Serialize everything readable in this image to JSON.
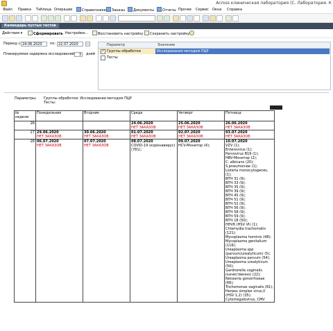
{
  "window": {
    "title": "Across клиническая лаборатория (С. Лаборатория. К"
  },
  "menu": [
    {
      "label": "Файл",
      "icon": "file-icon"
    },
    {
      "label": "Правка",
      "icon": ""
    },
    {
      "label": "Таблица",
      "icon": ""
    },
    {
      "label": "Операции",
      "icon": ""
    },
    {
      "label": "Справочники",
      "icon": "books-icon"
    },
    {
      "label": "Заказы",
      "icon": "orders-icon"
    },
    {
      "label": "Документы",
      "icon": "documents-icon"
    },
    {
      "label": "Отчеты",
      "icon": "reports-icon"
    },
    {
      "label": "Прочее",
      "icon": ""
    },
    {
      "label": "Сервис",
      "icon": ""
    },
    {
      "label": "Окна",
      "icon": ""
    },
    {
      "label": "Справка",
      "icon": ""
    }
  ],
  "tab": {
    "label": "Календарь пустых тестов"
  },
  "commands": {
    "actions": "Действия",
    "generate": "Сформировать",
    "settings": "Настройки...",
    "restore": "Восстановить настройку",
    "save": "Сохранить настройку"
  },
  "period": {
    "label": "Период с:",
    "from": "24.06.2020",
    "to_label": "по:",
    "to": "22.07.2020",
    "more": "..."
  },
  "delay": {
    "label": "Планируемая задержка исследований",
    "value": "3",
    "unit": "дней"
  },
  "params_table": {
    "col_param": "Параметр",
    "col_value": "Значение",
    "rows": [
      {
        "checked": "✓",
        "name": "Группы обработки",
        "value": "Исследования методом ПЦР"
      },
      {
        "checked": "",
        "name": "Тесты",
        "value": ""
      }
    ]
  },
  "report": {
    "params_label": "Параметры:",
    "groups_text": "Группы обработки: Исследования методом ПЦР",
    "tests_text": "Тесты:",
    "headers": [
      "№ недели",
      "Понедельник",
      "Вторник",
      "Среда",
      "Четверг",
      "Пятница"
    ],
    "no_orders": "НЕТ ЗАКАЗОВ",
    "weeks": [
      {
        "num": "26",
        "mon": "",
        "mon_status": "",
        "tue": "",
        "tue_status": "",
        "wed": "24.06.2020",
        "wed_status": "НЕТ ЗАКАЗОВ",
        "thu": "25.06.2020",
        "thu_status": "НЕТ ЗАКАЗОВ",
        "fri": "26.06.2020",
        "fri_status": "НЕТ ЗАКАЗОВ"
      },
      {
        "num": "27",
        "mon": "29.06.2020",
        "mon_status": "НЕТ ЗАКАЗОВ",
        "tue": "30.06.2020",
        "tue_status": "НЕТ ЗАКАЗОВ",
        "wed": "01.07.2020",
        "wed_status": "НЕТ ЗАКАЗОВ",
        "thu": "02.07.2020",
        "thu_status": "НЕТ ЗАКАЗОВ",
        "fri": "03.07.2020",
        "fri_status": "НЕТ ЗАКАЗОВ"
      },
      {
        "num": "28",
        "mon": "06.07.2020",
        "mon_status": "НЕТ ЗАКАЗОВ",
        "tue": "07.07.2020",
        "tue_status": "НЕТ ЗАКАЗОВ",
        "wed": "08.07.2020",
        "wed_status": "",
        "thu": "09.07.2020",
        "thu_status": "",
        "fri": "10.07.2020",
        "fri_status": ""
      }
    ],
    "wed_tests": [
      "COVID-19 (коронавирус)",
      "(781);"
    ],
    "thu_tests": [
      "HCV-Монитор (4);"
    ],
    "fri_tests": [
      "VZV (1);",
      "Enterovirus (1);",
      "Parvovirus B19 (1);",
      "HBV-Монитор (2);",
      "C. albicans (20);",
      "S.pneumoniae (1);",
      "Listeria monocytogenes,",
      "(1);",
      "ВПЧ 31 (9);",
      "ВПЧ 33 (9);",
      "ВПЧ 35 (9);",
      "ВПЧ 39 (9);",
      "ВПЧ 45 (9);",
      "ВПЧ 51 (9);",
      "ВПЧ 52 (9);",
      "ВПЧ 56 (9);",
      "ВПЧ 58 (9);",
      "ВПЧ 59 (9);",
      "ВПЧ 18 (50);",
      "HHV6 (HSV VI) (1);",
      "Chlamydia trachomatis",
      "(121);",
      "Mycoplasma hominis (48);",
      "Mycoplasma genitalium",
      "(116);",
      "Ureaplasma spp",
      "(parvum/urealyticum) (5);",
      "Ureaplasma parvum (54);",
      "Ureaplasma urealyticum",
      "(50);",
      "Gardnerella vaginalis",
      "(качественно) (22);",
      "Neisseria gonorrhoeae",
      "(66);",
      "Trichomonas vaginalis (81);",
      "Herpes simplex virus,II",
      "(HSV 1,2) (35);",
      "Cytomegalovirus, CMV"
    ]
  }
}
